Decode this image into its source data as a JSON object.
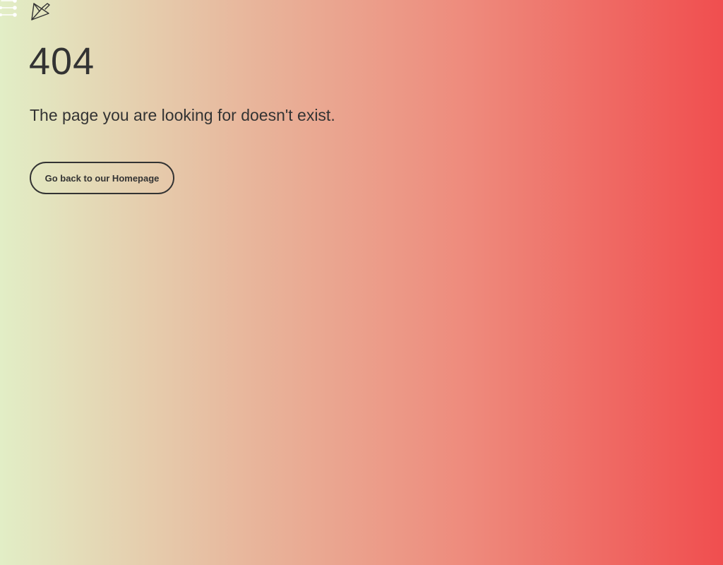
{
  "header": {
    "menu_icon": "menu-dots-icon",
    "logo_icon": "paper-bird-logo-icon"
  },
  "error": {
    "code": "404",
    "message": "The page you are looking for doesn't exist."
  },
  "actions": {
    "home_label": "Go back to our Homepage"
  },
  "colors": {
    "gradient_start": "#e2eec6",
    "gradient_mid": "#e8b59b",
    "gradient_end": "#f04e4f",
    "text": "#333333"
  }
}
